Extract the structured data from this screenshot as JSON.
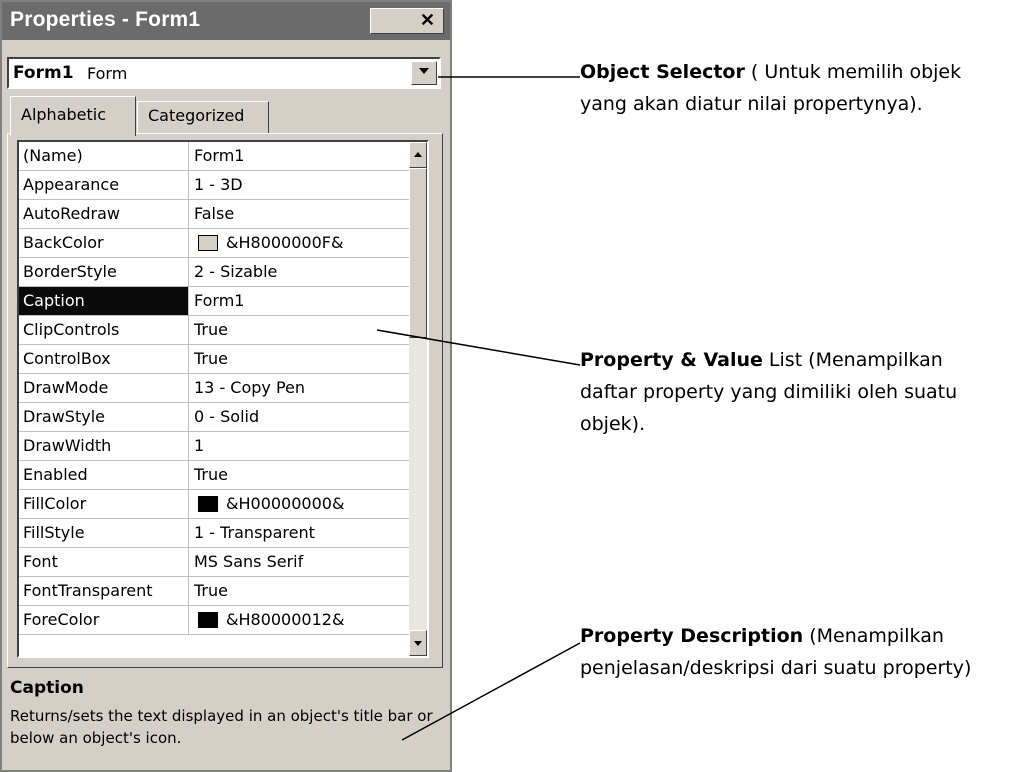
{
  "window": {
    "title": "Properties - Form1",
    "close_icon": "close-icon"
  },
  "object_selector": {
    "name": "Form1",
    "type": "Form"
  },
  "tabs": [
    {
      "label": "Alphabetic",
      "active": true
    },
    {
      "label": "Categorized",
      "active": false
    }
  ],
  "properties": [
    {
      "name": "(Name)",
      "value": "Form1"
    },
    {
      "name": "Appearance",
      "value": "1 - 3D"
    },
    {
      "name": "AutoRedraw",
      "value": "False"
    },
    {
      "name": "BackColor",
      "value": "&H8000000F&",
      "swatch": "#d4d0c8"
    },
    {
      "name": "BorderStyle",
      "value": "2 - Sizable"
    },
    {
      "name": "Caption",
      "value": "Form1",
      "selected": true
    },
    {
      "name": "ClipControls",
      "value": "True"
    },
    {
      "name": "ControlBox",
      "value": "True"
    },
    {
      "name": "DrawMode",
      "value": "13 - Copy Pen"
    },
    {
      "name": "DrawStyle",
      "value": "0 - Solid"
    },
    {
      "name": "DrawWidth",
      "value": "1"
    },
    {
      "name": "Enabled",
      "value": "True"
    },
    {
      "name": "FillColor",
      "value": "&H00000000&",
      "swatch": "#000000"
    },
    {
      "name": "FillStyle",
      "value": "1 - Transparent"
    },
    {
      "name": "Font",
      "value": "MS Sans Serif"
    },
    {
      "name": "FontTransparent",
      "value": "True"
    },
    {
      "name": "ForeColor",
      "value": "&H80000012&",
      "swatch": "#000000"
    }
  ],
  "description": {
    "title": "Caption",
    "text": "Returns/sets the text displayed in an object's title bar or below an object's icon."
  },
  "annotations": {
    "object_selector": {
      "bold": "Object Selector",
      "rest": " ( Untuk memilih objek yang akan diatur nilai propertynya)."
    },
    "property_list": {
      "bold": "Property & Value",
      "rest": " List (Menampilkan daftar property yang dimiliki oleh suatu objek)."
    },
    "property_description": {
      "bold": "Property Description",
      "rest": " (Menampilkan penjelasan/deskripsi dari suatu property)"
    }
  }
}
